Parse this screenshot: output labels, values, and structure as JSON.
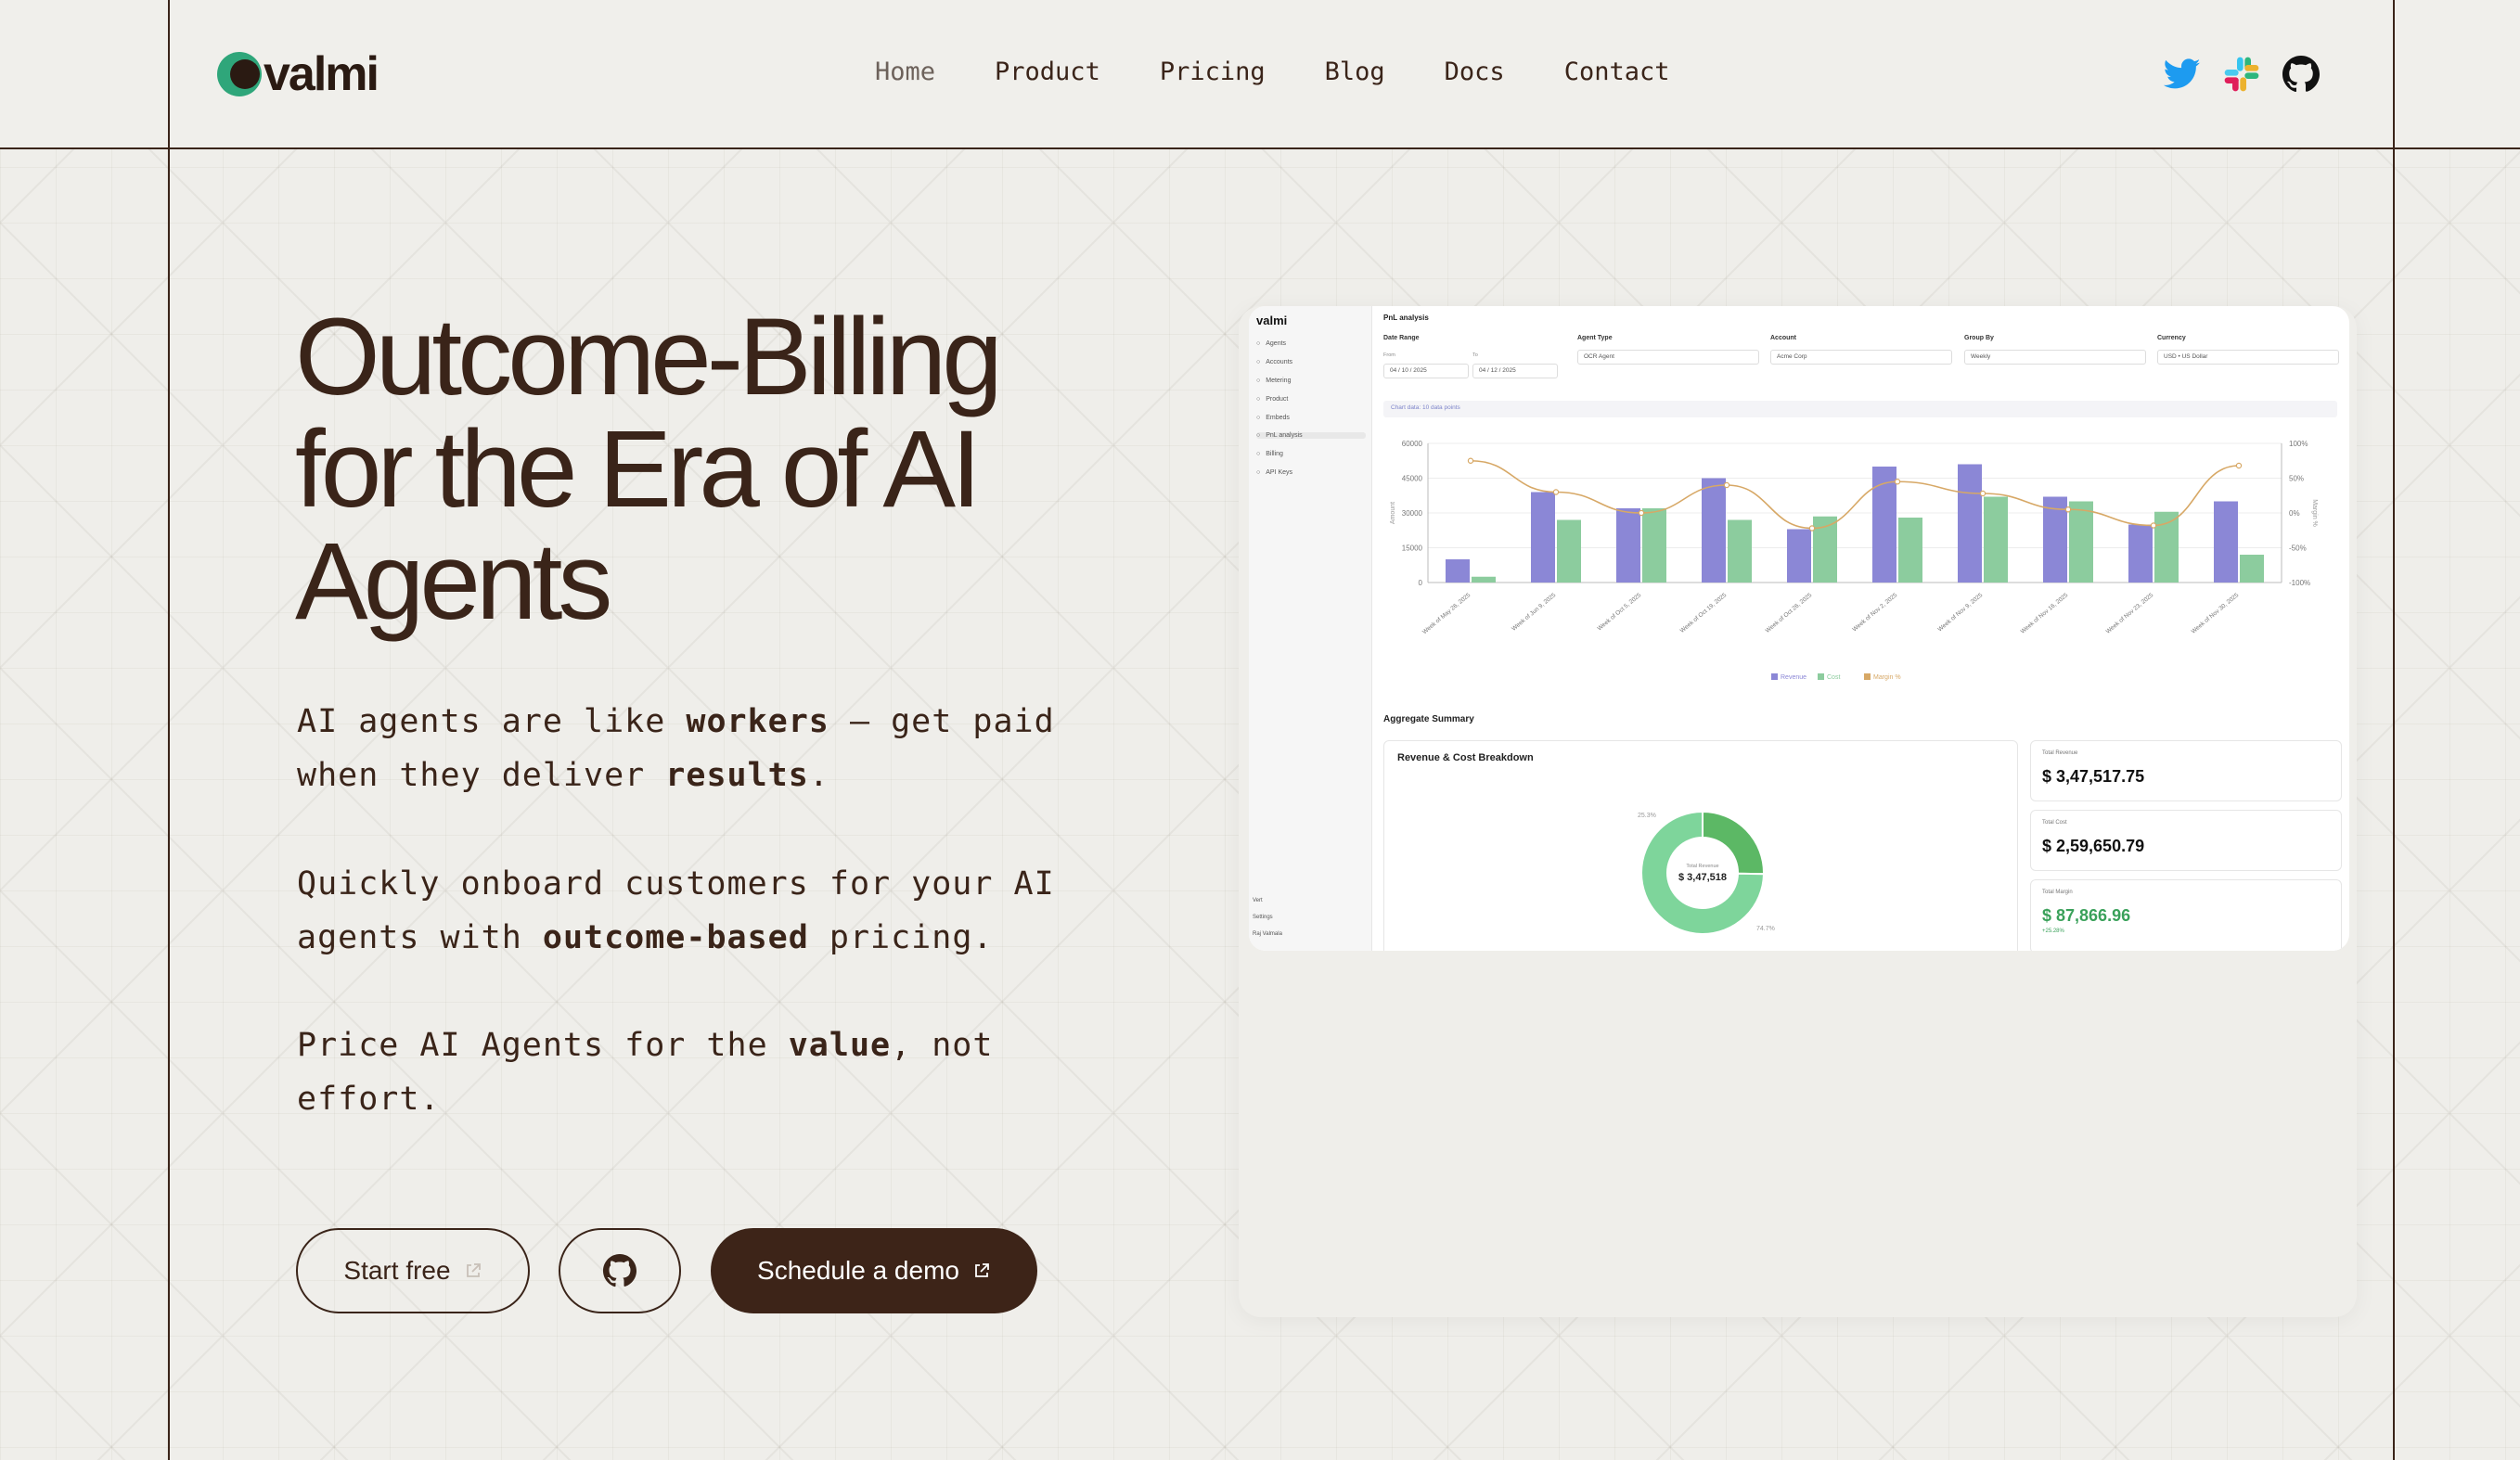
{
  "brand": {
    "name": "valmi",
    "color": "#2fa67a"
  },
  "nav": {
    "items": [
      {
        "label": "Home"
      },
      {
        "label": "Product"
      },
      {
        "label": "Pricing"
      },
      {
        "label": "Blog"
      },
      {
        "label": "Docs"
      },
      {
        "label": "Contact"
      }
    ]
  },
  "socials": {
    "icons": [
      "twitter-icon",
      "slack-icon",
      "github-icon"
    ]
  },
  "hero": {
    "title_line1": "Outcome-Billing",
    "title_line2": "for the Era of AI",
    "title_line3": "Agents",
    "p1": {
      "a": "AI agents are like ",
      "b": "workers",
      "c": " — get paid when they deliver ",
      "d": "results",
      "e": "."
    },
    "p2": {
      "a": "Quickly onboard customers for your AI agents with ",
      "b": "outcome-based",
      "c": " pricing."
    },
    "p3": {
      "a": "Price AI Agents for the ",
      "b": "value",
      "c": ", not effort."
    }
  },
  "buttons": {
    "start_free": "Start free",
    "schedule_demo": "Schedule a demo"
  },
  "preview": {
    "logo": "valmi",
    "crumb": "PnL analysis",
    "sidebar": [
      "Agents",
      "Accounts",
      "Metering",
      "Product",
      "Embeds",
      "PnL analysis",
      "Billing",
      "API Keys"
    ],
    "sidebar_bottom": [
      "Vert",
      "Settings",
      "Raj Valmala"
    ],
    "filters": {
      "date_range": "Date Range",
      "from_label": "From",
      "to_label": "To",
      "from": "04 / 10 / 2025",
      "to": "04 / 12 / 2025",
      "agent_type": "Agent Type",
      "agent_value": "OCR Agent",
      "account": "Account",
      "account_value": "Acme Corp",
      "group_by": "Group By",
      "group_value": "Weekly",
      "currency": "Currency",
      "currency_value": "USD • US Dollar"
    },
    "chip": "Chart data: 10 data points",
    "agg_title": "Aggregate Summary",
    "breakdown_title": "Revenue & Cost Breakdown",
    "donut_center_label": "Total Revenue",
    "donut_center_value": "$ 3,47,518",
    "donut_left_pct": "25.3%",
    "donut_right_pct": "74.7%",
    "stats": [
      {
        "label": "Total Revenue",
        "value": "$ 3,47,517.75"
      },
      {
        "label": "Total Cost",
        "value": "$ 2,59,650.79"
      },
      {
        "label": "Total Margin",
        "value": "$ 87,866.96",
        "sub": "+25.28%"
      }
    ]
  },
  "chart_data": {
    "type": "bar",
    "categories": [
      "Week of May 26, 2025",
      "Week of Jun 9, 2025",
      "Week of Oct 5, 2025",
      "Week of Oct 19, 2025",
      "Week of Oct 26, 2025",
      "Week of Nov 2, 2025",
      "Week of Nov 9, 2025",
      "Week of Nov 16, 2025",
      "Week of Nov 23, 2025",
      "Week of Nov 30, 2025"
    ],
    "series": [
      {
        "name": "Revenue",
        "type": "bar",
        "color": "#8b87d6",
        "values": [
          10000,
          39000,
          32000,
          45000,
          23000,
          50000,
          51000,
          37000,
          25000,
          35000
        ]
      },
      {
        "name": "Cost",
        "type": "bar",
        "color": "#8ccc9e",
        "values": [
          2500,
          27000,
          32000,
          27000,
          28500,
          28000,
          37000,
          35000,
          30500,
          12000
        ]
      },
      {
        "name": "Margin %",
        "type": "line",
        "color": "#d7a866",
        "values": [
          75,
          30,
          0,
          40,
          -22,
          45,
          28,
          5,
          -18,
          68
        ]
      }
    ],
    "yticks": [
      "0",
      "15000",
      "30000",
      "45000",
      "60000"
    ],
    "y2ticks": [
      "100%",
      "50%",
      "0%",
      "-50%",
      "-100%"
    ],
    "ylim": [
      0,
      60000
    ],
    "y2lim": [
      -100,
      100
    ],
    "ylabel": "Amount",
    "y2label": "Margin %",
    "legend": [
      "Revenue",
      "Cost",
      "Margin %"
    ]
  },
  "donut_data": {
    "values": [
      25.3,
      74.7
    ],
    "colors": [
      "#5cb865",
      "#7ed59b"
    ]
  }
}
